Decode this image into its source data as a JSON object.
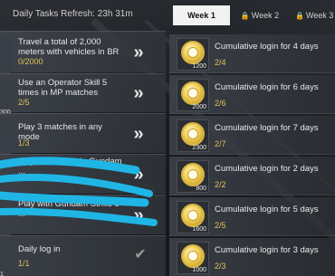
{
  "daily_header": "Daily Tasks Refresh: 23h 31m",
  "tabs": [
    {
      "label": "Week 1",
      "locked": false
    },
    {
      "label": "Week 2",
      "locked": true
    },
    {
      "label": "Week 3",
      "locked": true
    }
  ],
  "tasks": [
    {
      "title": "Travel a total of 2,000 meters with vehicles in BR",
      "progress": "0/2000",
      "thumb": "0"
    },
    {
      "title": "Use an Operator Skill 5 times in MP matches",
      "progress": "2/5",
      "thumb": "300"
    },
    {
      "title": "Play 3 matches in any mode",
      "progress": "1/3",
      "thumb": "0"
    },
    {
      "title": "Play one match in Gundam ...",
      "progress": "",
      "thumb": "0"
    },
    {
      "title": "Play with Gundam Strike 5 ...",
      "progress": "",
      "thumb": "0"
    },
    {
      "title": "Daily log in",
      "progress": "1/1",
      "thumb": "1"
    }
  ],
  "rewards": [
    {
      "title": "Cumulative login for 4 days",
      "progress": "2/4",
      "amount": "1200"
    },
    {
      "title": "Cumulative login for 6 days",
      "progress": "2/6",
      "amount": "2000"
    },
    {
      "title": "Cumulative login for 7 days",
      "progress": "2/7",
      "amount": "2300"
    },
    {
      "title": "Cumulative login for 2 days",
      "progress": "2/2",
      "amount": "800"
    },
    {
      "title": "Cumulative login for 5 days",
      "progress": "2/5",
      "amount": "1600"
    },
    {
      "title": "Cumulative login for 3 days",
      "progress": "2/3",
      "amount": "1000"
    }
  ],
  "icons": {
    "go": "double-chevron-right-icon",
    "done": "checkmark-icon",
    "lock": "lock-icon",
    "coin": "coin-icon"
  },
  "colors": {
    "progress": "#e0c25a",
    "active_tab": "#f2f2f2",
    "scribble": "#1fb6e6"
  }
}
